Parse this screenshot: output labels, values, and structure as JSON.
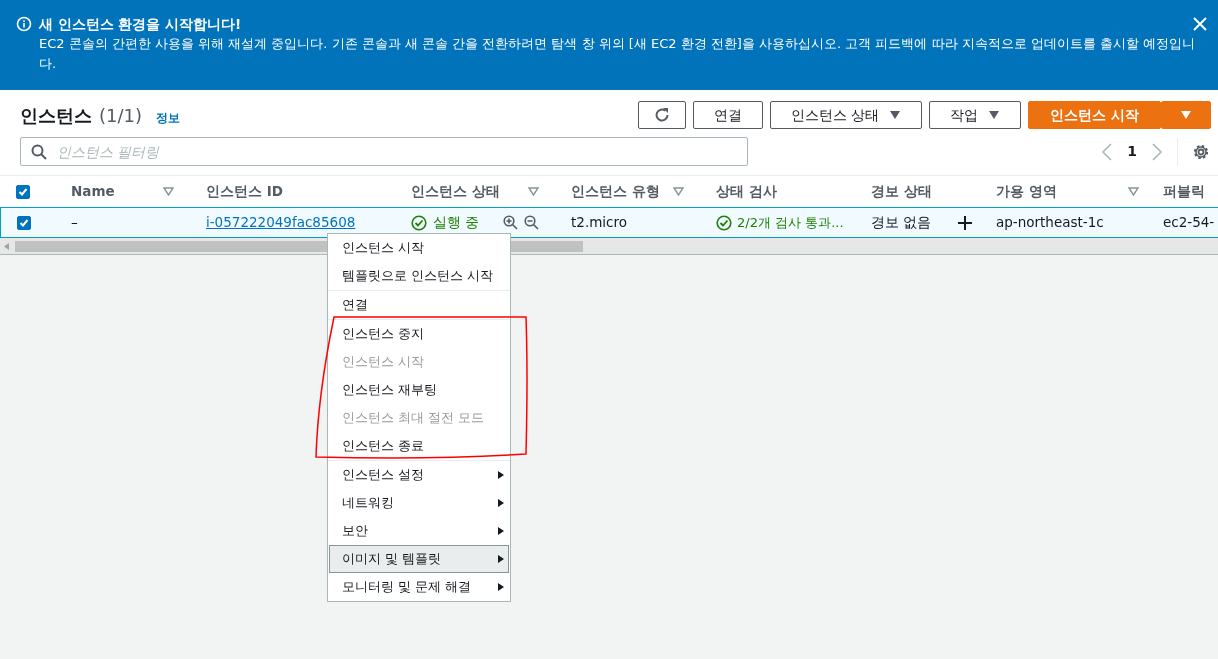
{
  "banner": {
    "title": "새 인스턴스 환경을 시작합니다!",
    "message": "EC2 콘솔의 간편한 사용을 위해 재설계 중입니다. 기존 콘솔과 새 콘솔 간을 전환하려면 탐색 창 위의 [새 EC2 환경 전환]을 사용하십시오. 고객 피드백에 따라 지속적으로 업데이트를 출시할 예정입니다."
  },
  "header": {
    "title": "인스턴스",
    "count": "(1/1)",
    "info_link": "정보"
  },
  "buttons": [
    {
      "kind": "icon"
    },
    {
      "kind": "plain",
      "label": "연결"
    },
    {
      "kind": "dropdown",
      "label": "인스턴스 상태"
    },
    {
      "kind": "dropdown",
      "label": "작업"
    },
    {
      "kind": "primary",
      "label": "인스턴스 시작"
    },
    {
      "kind": "split"
    }
  ],
  "filter": {
    "placeholder": "인스턴스 필터링"
  },
  "pagination": {
    "page": "1"
  },
  "table": {
    "all_checked": true,
    "columns": [
      {
        "label": "Name",
        "sortable": true
      },
      {
        "label": "인스턴스 ID",
        "sortable": false
      },
      {
        "label": "인스턴스 상태",
        "sortable": true
      },
      {
        "label": "인스턴스 유형",
        "sortable": true
      },
      {
        "label": "상태 검사",
        "sortable": false
      },
      {
        "label": "경보 상태",
        "sortable": false
      },
      {
        "label": "가용 영역",
        "sortable": true
      },
      {
        "label": "퍼블릭",
        "sortable": false
      }
    ],
    "rows": [
      {
        "selected": true,
        "name": "–",
        "instance_id": "i-057222049fac85608",
        "state": "실행 중",
        "type": "t2.micro",
        "status_check": "2/2개 검사 통과...",
        "alarm": "경보 없음",
        "zone": "ap-northeast-1c",
        "public": "ec2-54-"
      }
    ]
  },
  "menu": {
    "groups": [
      [
        {
          "label": "인스턴스 시작",
          "disabled": false,
          "submenu": false,
          "highlighted": false
        },
        {
          "label": "템플릿으로 인스턴스 시작",
          "disabled": false,
          "submenu": false,
          "highlighted": false
        }
      ],
      [
        {
          "label": "연결",
          "disabled": false,
          "submenu": false,
          "highlighted": false
        }
      ],
      [
        {
          "label": "인스턴스 중지",
          "disabled": false,
          "submenu": false,
          "highlighted": false
        },
        {
          "label": "인스턴스 시작",
          "disabled": true,
          "submenu": false,
          "highlighted": false
        },
        {
          "label": "인스턴스 재부팅",
          "disabled": false,
          "submenu": false,
          "highlighted": false
        },
        {
          "label": "인스턴스 최대 절전 모드",
          "disabled": true,
          "submenu": false,
          "highlighted": false
        },
        {
          "label": "인스턴스 종료",
          "disabled": false,
          "submenu": false,
          "highlighted": false
        }
      ],
      [
        {
          "label": "인스턴스 설정",
          "disabled": false,
          "submenu": true,
          "highlighted": false
        },
        {
          "label": "네트워킹",
          "disabled": false,
          "submenu": true,
          "highlighted": false
        },
        {
          "label": "보안",
          "disabled": false,
          "submenu": true,
          "highlighted": false
        },
        {
          "label": "이미지 및 템플릿",
          "disabled": false,
          "submenu": true,
          "highlighted": true
        },
        {
          "label": "모니터링 및 문제 해결",
          "disabled": false,
          "submenu": true,
          "highlighted": false
        }
      ]
    ]
  }
}
